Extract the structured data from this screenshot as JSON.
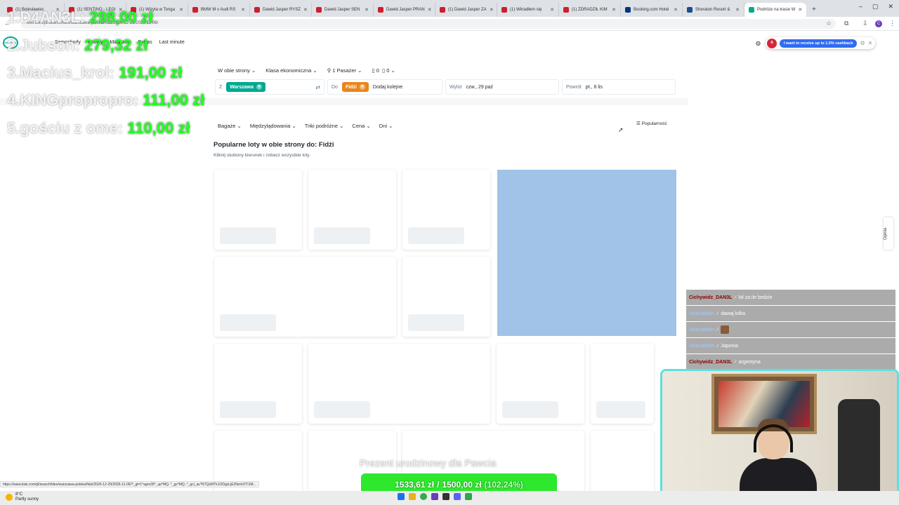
{
  "browser": {
    "tabs": [
      {
        "label": "(1) Bolesławiec"
      },
      {
        "label": "(1) SENTINO - LEGI"
      },
      {
        "label": "(1) Wizyta w Tonga"
      },
      {
        "label": "BMW M v Audi RS"
      },
      {
        "label": "Dawid Jasper RYSZ"
      },
      {
        "label": "Dawid Jasper SEN"
      },
      {
        "label": "Dawid Jasper PRAN"
      },
      {
        "label": "(1) Dawid Jasper ZA"
      },
      {
        "label": "(1) Wkradłem się"
      },
      {
        "label": "(1) ZDRADZIŁ KIM"
      },
      {
        "label": "Booking.com Hotel"
      },
      {
        "label": "Sheraton Resort &"
      },
      {
        "label": "Podróże na trasie W"
      }
    ],
    "url": "kiwi.com/pl/search/tiles/warszawa-polska/fidzi/2026-12-29/2026-11-06/",
    "status_url": "https://www.kiwi.com/pl/search/tiles/warszawa-polska/fidzi/2026-12-29/2026-11-06/?_gl=1*agro39*_up*MQ..*_gs*MQ..*_gcl_au*NTQzMTk1ODgxLjE3NzIxOTI1M..."
  },
  "kiwi_header": {
    "logo": "kiwi.com",
    "links": [
      "Samochody",
      "Pobyty",
      "Magazine",
      "Extras",
      "Last minute"
    ]
  },
  "cashback": {
    "label": "I want to receive up to 1.5% cashback"
  },
  "search": {
    "trip_type": "W obie strony",
    "cabin": "Klasa ekonomiczna",
    "passengers": "1 Pasażer",
    "bags_cabin": "0",
    "bags_checked": "0",
    "from_label": "Z",
    "from_chip": "Warszawa",
    "to_label": "Do",
    "to_chip": "Fidżi",
    "to_add": "Dodaj kolejne",
    "depart_label": "Wylot",
    "depart_value": "czw., 29 paź",
    "return_label": "Powrót",
    "return_value": "pt., 6 lis"
  },
  "filters": {
    "items": [
      "Bagaże",
      "Międzylądowania",
      "Triki podróżne",
      "Cena",
      "Dni"
    ],
    "sort": "Popularność"
  },
  "results": {
    "title": "Popularne loty w obie strony do: Fidżi",
    "subtitle": "Kliknij ulubiony kierunek i zobacz wszystkie loty."
  },
  "feedback": {
    "label": "Opinia"
  },
  "leaderboard": [
    {
      "name": "1.D4AN3L:",
      "amount": "298,00 zł"
    },
    {
      "name": "2.Jubson:",
      "amount": "279,32 zł"
    },
    {
      "name": "3.Macius_krol:",
      "amount": "191,00 zł"
    },
    {
      "name": "4.KINGpropropro:",
      "amount": "111,00 zł"
    },
    {
      "name": "5.gościu z ome:",
      "amount": "110,00 zł"
    }
  ],
  "chat": [
    {
      "user": "Cichywidz_DAN3L",
      "text": "lol za ile bedzie"
    },
    {
      "user": "StrazakBen",
      "text": "dawaj lolka"
    },
    {
      "user": "StrazakBen",
      "text": ""
    },
    {
      "user": "StrazakBen",
      "text": "Japonia"
    },
    {
      "user": "Cichywidz_DAN3L",
      "text": "argentyna"
    }
  ],
  "donation_goal": {
    "title": "Prezent urodzinowy dla Pawcia",
    "current": "1533,61 zł",
    "separator": "/",
    "target": "1500,00 zł",
    "percent": "(102,24%)"
  },
  "taskbar": {
    "temperature": "8°C",
    "weather": "Partly sunny"
  },
  "colors": {
    "kiwi_green": "#00a991",
    "warszawa_chip": "#00a991",
    "fidzi_chip": "#f5a623",
    "map": "#a0c3e7",
    "donation_green": "#2ee82e"
  }
}
